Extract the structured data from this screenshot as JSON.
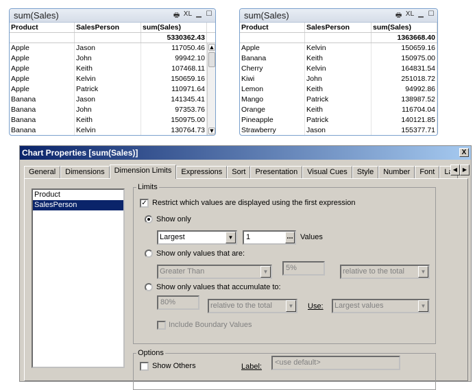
{
  "left_table": {
    "title": "sum(Sales)",
    "icons": [
      "print-icon",
      "XL",
      "minimize-icon",
      "maximize-icon"
    ],
    "headers": [
      "Product",
      "SalesPerson",
      "sum(Sales)"
    ],
    "total": "5330362.43",
    "rows": [
      [
        "Apple",
        "Jason",
        "117050.46"
      ],
      [
        "Apple",
        "John",
        "99942.10"
      ],
      [
        "Apple",
        "Keith",
        "107468.11"
      ],
      [
        "Apple",
        "Kelvin",
        "150659.16"
      ],
      [
        "Apple",
        "Patrick",
        "110971.64"
      ],
      [
        "Banana",
        "Jason",
        "141345.41"
      ],
      [
        "Banana",
        "John",
        "97353.76"
      ],
      [
        "Banana",
        "Keith",
        "150975.00"
      ],
      [
        "Banana",
        "Kelvin",
        "130764.73"
      ]
    ]
  },
  "right_table": {
    "title": "sum(Sales)",
    "headers": [
      "Product",
      "SalesPerson",
      "sum(Sales)"
    ],
    "total": "1363668.40",
    "rows": [
      [
        "Apple",
        "Kelvin",
        "150659.16"
      ],
      [
        "Banana",
        "Keith",
        "150975.00"
      ],
      [
        "Cherry",
        "Kelvin",
        "164831.54"
      ],
      [
        "Kiwi",
        "John",
        "251018.72"
      ],
      [
        "Lemon",
        "Keith",
        "94992.86"
      ],
      [
        "Mango",
        "Patrick",
        "138987.52"
      ],
      [
        "Orange",
        "Keith",
        "116704.04"
      ],
      [
        "Pineapple",
        "Patrick",
        "140121.85"
      ],
      [
        "Strawberry",
        "Jason",
        "155377.71"
      ]
    ]
  },
  "dialog": {
    "title": "Chart Properties [sum(Sales)]",
    "close": "X",
    "tabs": [
      "General",
      "Dimensions",
      "Dimension Limits",
      "Expressions",
      "Sort",
      "Presentation",
      "Visual Cues",
      "Style",
      "Number",
      "Font",
      "La"
    ],
    "active_tab": "Dimension Limits",
    "dimensions": [
      "Product",
      "SalesPerson"
    ],
    "selected_dimension": "SalesPerson",
    "limits": {
      "legend": "Limits",
      "restrict_label": "Restrict which values are displayed using the first expression",
      "restrict_checked": true,
      "show_only_label": "Show only",
      "show_only_mode": "Largest",
      "show_only_count": "1",
      "values_label": "Values",
      "dots": "...",
      "show_values_label": "Show only values that are:",
      "compare_mode": "Greater Than",
      "compare_pct": "5%",
      "compare_relative": "relative to the total",
      "accumulate_label": "Show only values that accumulate to:",
      "accumulate_pct": "80%",
      "accumulate_relative": "relative to the total",
      "use_label": "Use:",
      "use_value": "Largest values",
      "boundary_label": "Include Boundary Values"
    },
    "options": {
      "legend": "Options",
      "show_others_label": "Show Others",
      "label_label": "Label:",
      "label_placeholder": "<use default>"
    }
  }
}
